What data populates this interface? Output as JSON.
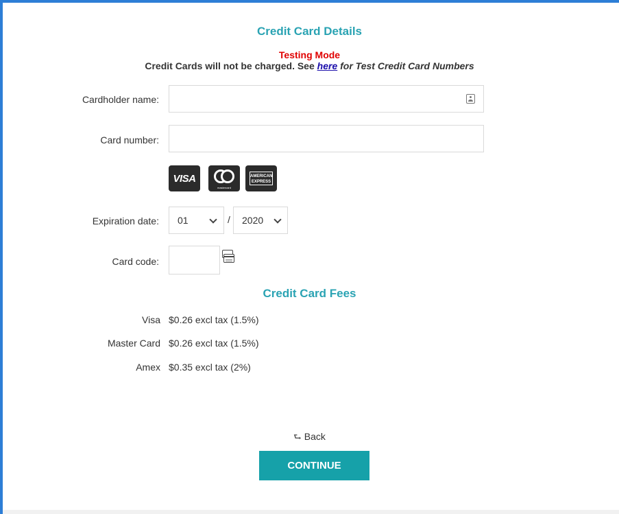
{
  "header": {
    "title": "Credit Card Details",
    "testing_mode": "Testing Mode",
    "notice_prefix": "Credit Cards will not be charged. See ",
    "notice_link": "here",
    "notice_suffix": " for Test Credit Card Numbers"
  },
  "form": {
    "cardholder_label": "Cardholder name:",
    "cardholder_value": "",
    "card_number_label": "Card number:",
    "card_number_value": "",
    "card_logos": [
      "Visa",
      "Mastercard",
      "American Express"
    ],
    "visa_text": "VISA",
    "mastercard_text": "mastercard",
    "amex_text": "AMERICAN EXPRESS",
    "expiration_label": "Expiration date:",
    "exp_month": "01",
    "exp_separator": "/",
    "exp_year": "2020",
    "card_code_label": "Card code:",
    "card_code_value": ""
  },
  "fees": {
    "title": "Credit Card Fees",
    "items": [
      {
        "name": "Visa",
        "value": "$0.26 excl tax (1.5%)"
      },
      {
        "name": "Master Card",
        "value": "$0.26 excl tax (1.5%)"
      },
      {
        "name": "Amex",
        "value": "$0.35 excl tax (2%)"
      }
    ]
  },
  "footer": {
    "back_label": "Back",
    "continue_label": "CONTINUE"
  },
  "colors": {
    "accent_teal": "#2aa3b3",
    "button_teal": "#16a1a9",
    "testing_red": "#e00000",
    "frame_blue": "#2d7ed6"
  },
  "icons": {
    "contact_card": "contact-card-icon",
    "chevron": "chevron-down-icon",
    "card_code": "card-code-icon",
    "back": "back-arrow-icon"
  }
}
